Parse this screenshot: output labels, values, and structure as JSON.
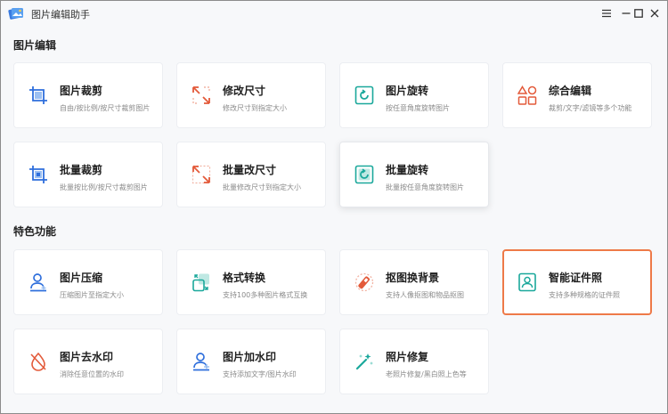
{
  "window": {
    "title": "图片编辑助手",
    "controls": [
      "menu-icon",
      "minimize-icon",
      "maximize-icon",
      "close-icon"
    ]
  },
  "sections": [
    {
      "title": "图片编辑",
      "cards": [
        {
          "title": "图片裁剪",
          "desc": "自由/按比例/按尺寸裁剪图片",
          "icon": "crop-icon",
          "color": "#2f6fdc"
        },
        {
          "title": "修改尺寸",
          "desc": "修改尺寸到指定大小",
          "icon": "resize-icon",
          "color": "#e35a3a"
        },
        {
          "title": "图片旋转",
          "desc": "按任意角度旋转图片",
          "icon": "rotate-icon",
          "color": "#1aa89b"
        },
        {
          "title": "综合编辑",
          "desc": "裁剪/文字/滤镜等多个功能",
          "icon": "shapes-icon",
          "color": "#e35a3a"
        },
        {
          "title": "批量裁剪",
          "desc": "批量按比例/按尺寸裁剪图片",
          "icon": "batch-crop-icon",
          "color": "#2f6fdc"
        },
        {
          "title": "批量改尺寸",
          "desc": "批量修改尺寸到指定大小",
          "icon": "batch-resize-icon",
          "color": "#e35a3a"
        },
        {
          "title": "批量旋转",
          "desc": "批量按任意角度旋转图片",
          "icon": "batch-rotate-icon",
          "color": "#1aa89b"
        }
      ]
    },
    {
      "title": "特色功能",
      "cards": [
        {
          "title": "图片压缩",
          "desc": "压缩图片至指定大小",
          "icon": "compress-icon",
          "color": "#2f6fdc"
        },
        {
          "title": "格式转换",
          "desc": "支持100多种图片格式互换",
          "icon": "convert-icon",
          "color": "#1aa89b"
        },
        {
          "title": "抠图换背景",
          "desc": "支持人像抠图和物品抠图",
          "icon": "cutout-icon",
          "color": "#e35a3a"
        },
        {
          "title": "智能证件照",
          "desc": "支持多种规格的证件照",
          "icon": "id-photo-icon",
          "color": "#1aa89b"
        },
        {
          "title": "图片去水印",
          "desc": "消除任意位置的水印",
          "icon": "remove-watermark-icon",
          "color": "#e35a3a"
        },
        {
          "title": "图片加水印",
          "desc": "支持添加文字/图片水印",
          "icon": "add-watermark-icon",
          "color": "#2f6fdc"
        },
        {
          "title": "照片修复",
          "desc": "老照片修复/黑白照上色等",
          "icon": "magic-wand-icon",
          "color": "#1aa89b"
        }
      ]
    }
  ],
  "accent_selected": "#ee7a48"
}
